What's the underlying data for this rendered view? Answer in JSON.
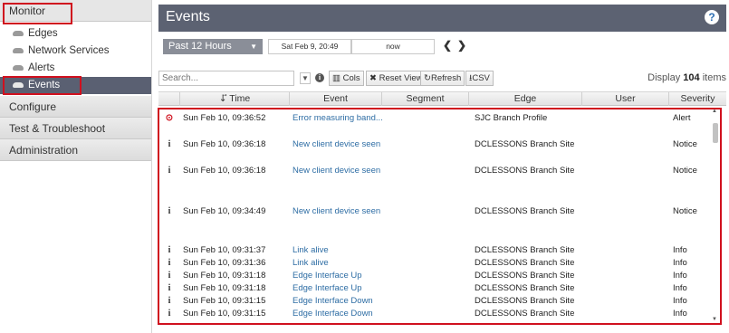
{
  "sidebar": {
    "monitor": "Monitor",
    "items": [
      {
        "label": "Edges"
      },
      {
        "label": "Network Services"
      },
      {
        "label": "Alerts"
      },
      {
        "label": "Events"
      }
    ],
    "configure": "Configure",
    "test": "Test & Troubleshoot",
    "admin": "Administration"
  },
  "header": {
    "title": "Events",
    "help": "?"
  },
  "timebar": {
    "range": "Past 12 Hours",
    "start": "Sat Feb 9, 20:49",
    "end": "now",
    "prev": "❮",
    "next": "❯"
  },
  "toolbar": {
    "search_placeholder": "Search...",
    "cols": "Cols",
    "reset": "Reset View",
    "refresh": "Refresh",
    "csv": "CSV",
    "display_prefix": "Display",
    "display_count": "104",
    "display_suffix": "items"
  },
  "table": {
    "headers": {
      "time": "Time",
      "event": "Event",
      "segment": "Segment",
      "edge": "Edge",
      "user": "User",
      "severity": "Severity"
    },
    "rows": [
      {
        "icon": "alert-icon",
        "time": "Sun Feb 10, 09:36:52",
        "event": "Error measuring band...",
        "edge": "SJC Branch Profile",
        "severity": "Alert"
      },
      {
        "icon": "info-icon",
        "time": "Sun Feb 10, 09:36:18",
        "event": "New client device seen",
        "edge": "DCLESSONS Branch Site",
        "severity": "Notice"
      },
      {
        "icon": "info-icon",
        "time": "Sun Feb 10, 09:36:18",
        "event": "New client device seen",
        "edge": "DCLESSONS Branch Site",
        "severity": "Notice"
      },
      {
        "icon": "info-icon",
        "time": "Sun Feb 10, 09:34:49",
        "event": "New client device seen",
        "edge": "DCLESSONS Branch Site",
        "severity": "Notice"
      },
      {
        "icon": "info-icon",
        "time": "Sun Feb 10, 09:31:37",
        "event": "Link alive",
        "edge": "DCLESSONS Branch Site",
        "severity": "Info"
      },
      {
        "icon": "info-icon",
        "time": "Sun Feb 10, 09:31:36",
        "event": "Link alive",
        "edge": "DCLESSONS Branch Site",
        "severity": "Info"
      },
      {
        "icon": "info-icon",
        "time": "Sun Feb 10, 09:31:18",
        "event": "Edge Interface Up",
        "edge": "DCLESSONS Branch Site",
        "severity": "Info"
      },
      {
        "icon": "info-icon",
        "time": "Sun Feb 10, 09:31:18",
        "event": "Edge Interface Up",
        "edge": "DCLESSONS Branch Site",
        "severity": "Info"
      },
      {
        "icon": "info-icon",
        "time": "Sun Feb 10, 09:31:15",
        "event": "Edge Interface Down",
        "edge": "DCLESSONS Branch Site",
        "severity": "Info"
      },
      {
        "icon": "info-icon",
        "time": "Sun Feb 10, 09:31:15",
        "event": "Edge Interface Down",
        "edge": "DCLESSONS Branch Site",
        "severity": "Info"
      }
    ]
  },
  "colors": {
    "highlight": "#d0101e",
    "header_bg": "#5c6272",
    "link": "#2e6da4"
  }
}
